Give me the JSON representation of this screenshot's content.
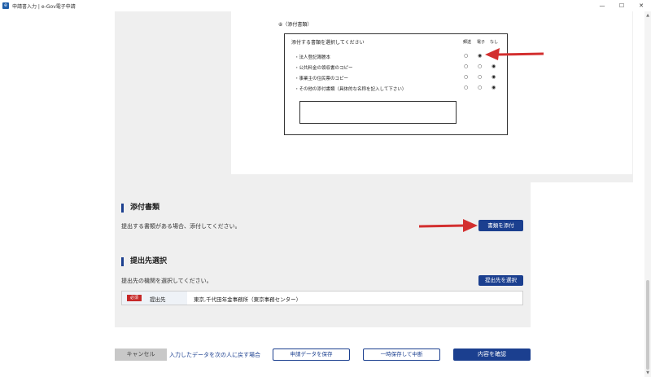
{
  "window": {
    "icon": "app-icon",
    "title": "申請書入力 | e-Gov電子申請",
    "minimize": "—",
    "maximize": "☐",
    "close": "✕"
  },
  "preview": {
    "heading": "⑧（添付書類）",
    "box_title": "添付する書類を選択してください",
    "columns": [
      "郵送",
      "電子",
      "なし"
    ],
    "rows": [
      {
        "label": "・法人登記簿謄本",
        "selected": "電子"
      },
      {
        "label": "・公共料金の領収書のコピー",
        "selected": "なし"
      },
      {
        "label": "・事業主の住民票のコピー",
        "selected": "なし"
      },
      {
        "label": "・その他の添付書類（具体的な名称を記入して下さい）",
        "selected": "なし"
      }
    ]
  },
  "attachments": {
    "title": "添付書類",
    "description": "提出する書類がある場合、添付してください。",
    "button": "書類を添付"
  },
  "destination": {
    "title": "提出先選択",
    "description": "提出先の機関を選択してください。",
    "button": "提出先を選択",
    "required_badge": "必須",
    "label": "提出先",
    "value": "東京,千代田年金事務所（東京事務センター）"
  },
  "footer": {
    "cancel": "キャンセル",
    "back_link": "入力したデータを次の人に戻す場合",
    "save": "申請データを保存",
    "suspend": "一時保存して中断",
    "confirm": "内容を確認"
  },
  "colors": {
    "accent": "#1b3f8f",
    "required": "#c62828",
    "annotation_arrow": "#d32f2f"
  }
}
